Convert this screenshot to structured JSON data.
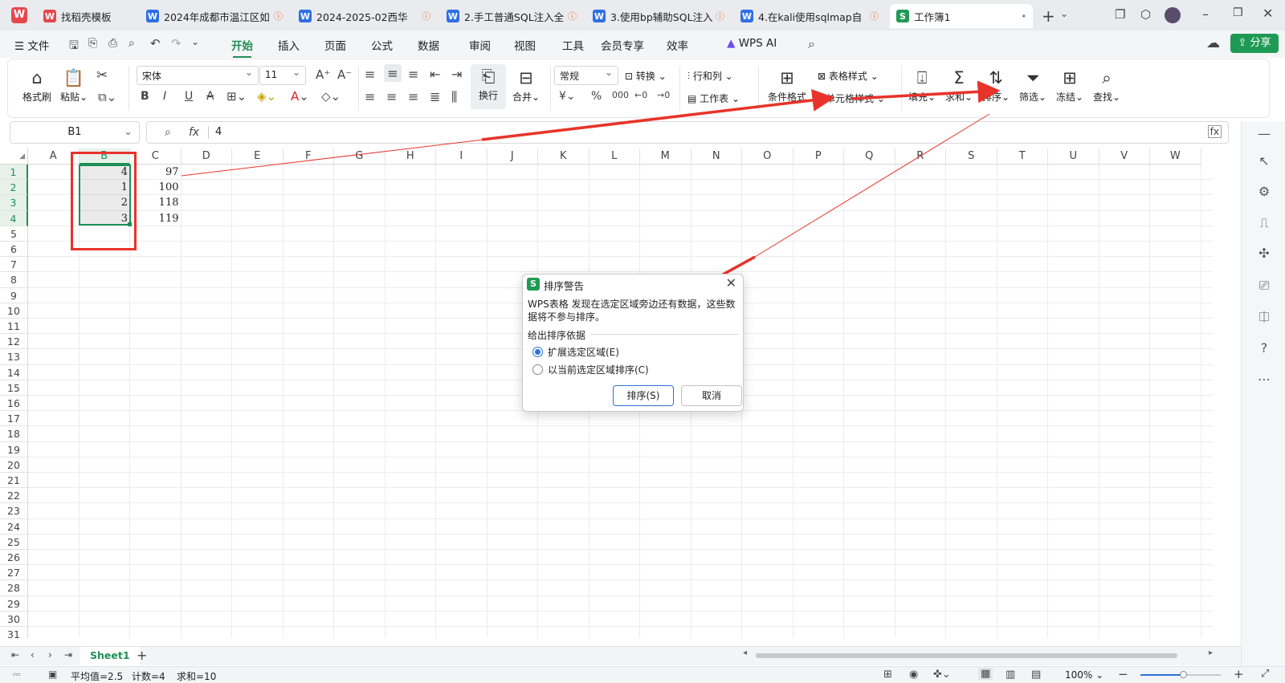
{
  "tabs": [
    {
      "label": "找稻壳模板",
      "logo": "W",
      "logo_color": "#e5484d",
      "marker": ""
    },
    {
      "label": "2024年成都市温江区如",
      "logo": "W",
      "logo_color": "#2f6fe4",
      "marker": "ⓘ"
    },
    {
      "label": "2024-2025-02西华",
      "logo": "W",
      "logo_color": "#2f6fe4",
      "marker": "ⓘ"
    },
    {
      "label": "2.手工普通SQL注入全",
      "logo": "W",
      "logo_color": "#2f6fe4",
      "marker": "ⓘ"
    },
    {
      "label": "3.使用bp辅助SQL注入",
      "logo": "W",
      "logo_color": "#2f6fe4",
      "marker": "ⓘ"
    },
    {
      "label": "4.在kali使用sqlmap自",
      "logo": "W",
      "logo_color": "#2f6fe4",
      "marker": "ⓘ"
    },
    {
      "label": "工作簿1",
      "logo": "S",
      "logo_color": "#1f9a55",
      "marker": "•"
    }
  ],
  "menu": {
    "file": "文件",
    "items": [
      "开始",
      "插入",
      "页面",
      "公式",
      "数据",
      "审阅",
      "视图",
      "工具",
      "会员专享",
      "效率"
    ],
    "wps_ai": "WPS AI",
    "share": "分享"
  },
  "ribbon": {
    "format_painter": "格式刷",
    "paste": "粘贴",
    "font_name": "宋体",
    "font_size": "11",
    "wrap": "换行",
    "merge": "合并",
    "number_format": "常规",
    "convert": "转换",
    "rows_cols": "行和列",
    "worksheet": "工作表",
    "cond_format": "条件格式",
    "table_style": "表格样式",
    "cell_style": "单元格样式",
    "fill": "填充",
    "sum": "求和",
    "sort": "排序",
    "filter": "筛选",
    "freeze": "冻结",
    "find": "查找"
  },
  "formula_bar": {
    "name_box": "B1",
    "fx": "fx",
    "value": "4"
  },
  "columns": [
    "A",
    "B",
    "C",
    "D",
    "E",
    "F",
    "G",
    "H",
    "I",
    "J",
    "K",
    "L",
    "M",
    "N",
    "O",
    "P",
    "Q",
    "R",
    "S",
    "T",
    "U",
    "V",
    "W"
  ],
  "rows": [
    "1",
    "2",
    "3",
    "4",
    "5",
    "6",
    "7",
    "8",
    "9",
    "10",
    "11",
    "12",
    "13",
    "14",
    "15",
    "16",
    "17",
    "18",
    "19",
    "20",
    "21",
    "22",
    "23",
    "24",
    "25",
    "26",
    "27",
    "28",
    "29",
    "30",
    "31"
  ],
  "cells": {
    "B": [
      "4",
      "1",
      "2",
      "3"
    ],
    "C": [
      "97",
      "100",
      "118",
      "119"
    ]
  },
  "dialog": {
    "title": "排序警告",
    "message": "WPS表格 发现在选定区域旁边还有数据，这些数据将不参与排序。",
    "group_label": "给出排序依据",
    "option_expand": "扩展选定区域(E)",
    "option_current": "以当前选定区域排序(C)",
    "sort_button": "排序(S)",
    "cancel_button": "取消"
  },
  "sheet_tab": "Sheet1",
  "status": {
    "average": "平均值=2.5",
    "count": "计数=4",
    "sum": "求和=10",
    "zoom": "100%"
  },
  "colors": {
    "accent": "#1f8f55",
    "annotation": "#e8332a"
  }
}
